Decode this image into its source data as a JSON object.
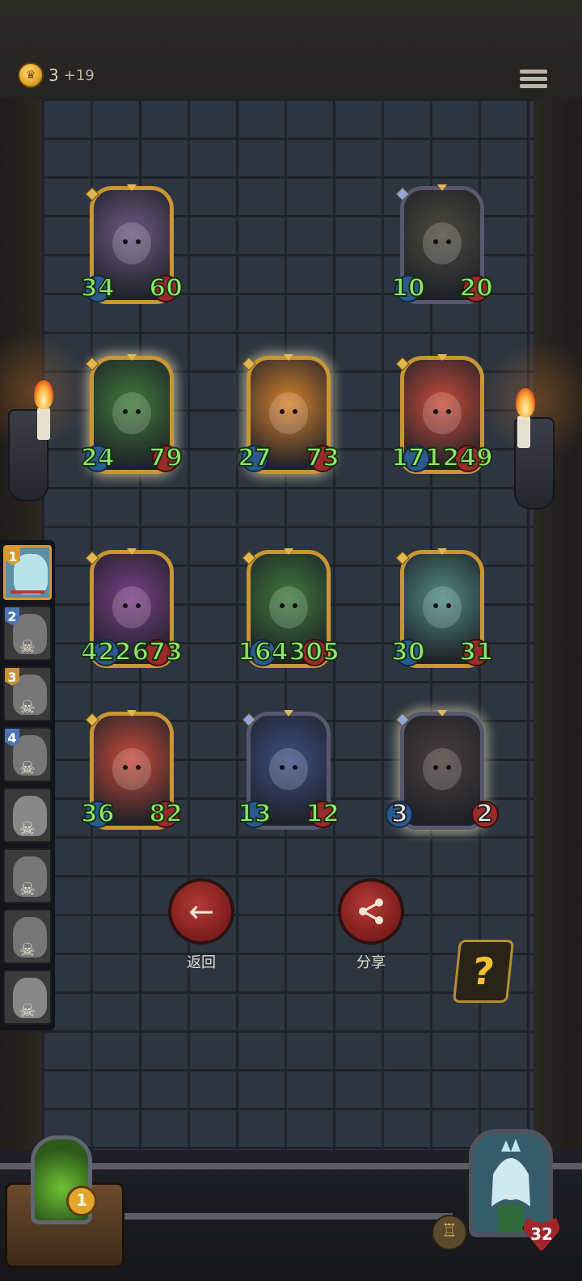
{
  "header": {
    "gold": "3",
    "gold_income": "+19",
    "coin_icon": "crown-coin-icon",
    "menu_icon": "hamburger-menu-icon"
  },
  "board": {
    "rows": [
      [
        {
          "name": "mushroom-creature",
          "atk": "34",
          "hp": "60",
          "frame": "gold",
          "glow": false,
          "portrait_color": "#6e5a82"
        },
        {
          "name": "witch-hat-elder",
          "atk": "10",
          "hp": "20",
          "frame": "silver",
          "glow": false,
          "portrait_color": "#4d4a3c"
        }
      ],
      [
        {
          "name": "leaf-girl",
          "atk": "24",
          "hp": "79",
          "frame": "gold",
          "glow": true,
          "portrait_color": "#3f7a3a"
        },
        {
          "name": "pumpkin-head",
          "atk": "27",
          "hp": "73",
          "frame": "gold",
          "glow": true,
          "portrait_color": "#d7812c"
        },
        {
          "name": "tomato-demon",
          "atk": "171",
          "hp": "249",
          "frame": "gold",
          "glow": false,
          "portrait_color": "#c84b3a"
        }
      ],
      [
        {
          "name": "bramble-tree",
          "atk": "422",
          "hp": "673",
          "frame": "gold",
          "glow": false,
          "portrait_color": "#7a3e86"
        },
        {
          "name": "leaf-girl",
          "atk": "164",
          "hp": "305",
          "frame": "gold",
          "glow": false,
          "portrait_color": "#3f7a3a"
        },
        {
          "name": "goblin-ghost",
          "atk": "30",
          "hp": "31",
          "frame": "gold",
          "glow": false,
          "portrait_color": "#4f8a86"
        }
      ],
      [
        {
          "name": "tomato-demon",
          "atk": "36",
          "hp": "82",
          "frame": "gold",
          "glow": false,
          "portrait_color": "#c84b3a"
        },
        {
          "name": "elf-sorceress",
          "atk": "13",
          "hp": "12",
          "frame": "silver",
          "glow": false,
          "portrait_color": "#3d4f84"
        },
        {
          "name": "rabbit-masked",
          "atk": "3",
          "hp": "2",
          "frame": "silver",
          "glow": true,
          "portrait_color": "#4a3f3a",
          "stat_style": "white"
        }
      ]
    ]
  },
  "party": [
    {
      "num": "1",
      "active": true,
      "badge_color": "#d69a2c",
      "face_color": "#b9e3e8"
    },
    {
      "num": "2",
      "active": false,
      "badge_color": "#4a76b8",
      "face_color": "#777"
    },
    {
      "num": "3",
      "active": false,
      "badge_color": "#c9913a",
      "face_color": "#777"
    },
    {
      "num": "4",
      "active": false,
      "badge_color": "#4a76b8",
      "face_color": "#777"
    },
    {
      "num": "",
      "active": false,
      "badge_color": "",
      "face_color": "#888"
    },
    {
      "num": "",
      "active": false,
      "badge_color": "",
      "face_color": "#777"
    },
    {
      "num": "",
      "active": false,
      "badge_color": "",
      "face_color": "#777"
    },
    {
      "num": "",
      "active": false,
      "badge_color": "",
      "face_color": "#888"
    }
  ],
  "actions": {
    "back_label": "返回",
    "back_icon": "arrow-left-icon",
    "share_label": "分享",
    "share_icon": "share-icon",
    "help_icon": "question-mark-icon"
  },
  "footer": {
    "potion_level": "1",
    "hero_hp": "32",
    "hero_icon": "fairy-queen-portrait",
    "knight_icon": "knight-helmet-icon"
  }
}
